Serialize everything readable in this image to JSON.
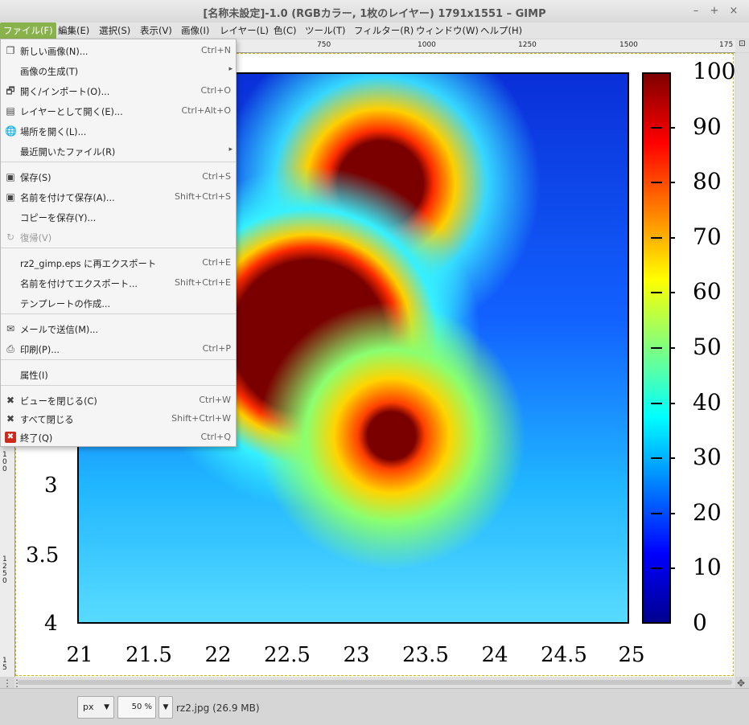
{
  "window": {
    "title": "[名称未設定]-1.0 (RGBカラー, 1枚のレイヤー) 1791x1551 – GIMP"
  },
  "menubar": [
    {
      "label": "ファイル(F)",
      "active": true
    },
    {
      "label": "編集(E)"
    },
    {
      "label": "選択(S)"
    },
    {
      "label": "表示(V)"
    },
    {
      "label": "画像(I)"
    },
    {
      "label": "レイヤー(L)"
    },
    {
      "label": "色(C)"
    },
    {
      "label": "ツール(T)"
    },
    {
      "label": "フィルター(R)"
    },
    {
      "label": "ウィンドウ(W)"
    },
    {
      "label": "ヘルプ(H)"
    }
  ],
  "file_menu": [
    {
      "label": "新しい画像(N)...",
      "shortcut": "Ctrl+N",
      "icon": "new-image-icon",
      "glyph": "❐"
    },
    {
      "label": "画像の生成(T)",
      "submenu": "▸"
    },
    {
      "label": "開く/インポート(O)...",
      "shortcut": "Ctrl+O",
      "icon": "open-icon",
      "glyph": "🗗"
    },
    {
      "label": "レイヤーとして開く(E)...",
      "shortcut": "Ctrl+Alt+O",
      "icon": "open-as-layer-icon",
      "glyph": "▤"
    },
    {
      "label": "場所を開く(L)...",
      "icon": "globe-icon",
      "glyph": "🌐"
    },
    {
      "label": "最近開いたファイル(R)",
      "submenu": "▸"
    },
    {
      "label": "保存(S)",
      "shortcut": "Ctrl+S",
      "icon": "save-icon",
      "glyph": "▣"
    },
    {
      "label": "名前を付けて保存(A)...",
      "shortcut": "Shift+Ctrl+S",
      "icon": "save-as-icon",
      "glyph": "▣"
    },
    {
      "label": "コピーを保存(Y)..."
    },
    {
      "label": "復帰(V)",
      "icon": "revert-icon",
      "glyph": "↻",
      "disabled": true
    },
    {
      "label": "rz2_gimp.eps に再エクスポート",
      "shortcut": "Ctrl+E"
    },
    {
      "label": "名前を付けてエクスポート...",
      "shortcut": "Shift+Ctrl+E"
    },
    {
      "label": "テンプレートの作成..."
    },
    {
      "label": "メールで送信(M)...",
      "icon": "mail-icon",
      "glyph": "✉"
    },
    {
      "label": "印刷(P)...",
      "shortcut": "Ctrl+P",
      "icon": "print-icon",
      "glyph": "⎙"
    },
    {
      "label": "属性(I)"
    },
    {
      "label": "ビューを閉じる(C)",
      "shortcut": "Ctrl+W",
      "icon": "close-view-icon",
      "glyph": "✖"
    },
    {
      "label": "すべて閉じる",
      "shortcut": "Shift+Ctrl+W",
      "icon": "close-all-icon",
      "glyph": "✖"
    },
    {
      "label": "終了(Q)",
      "shortcut": "Ctrl+Q",
      "icon": "quit-icon",
      "glyph": "✖"
    }
  ],
  "ruler": {
    "h_labels": [
      "750",
      "1000",
      "1250",
      "1500",
      "175"
    ],
    "v_labels": [
      "100",
      "1250",
      "15"
    ]
  },
  "plot": {
    "x_ticks": [
      "21",
      "21.5",
      "22",
      "22.5",
      "23",
      "23.5",
      "24",
      "24.5",
      "25"
    ],
    "y_ticks": [
      "3",
      "3.5",
      "4"
    ],
    "colorbar_ticks": [
      "100",
      "90",
      "80",
      "70",
      "60",
      "50",
      "40",
      "30",
      "20",
      "10",
      "0"
    ],
    "colorbar_colors": [
      "#7f0000",
      "#ff0000",
      "#ff8000",
      "#ffff00",
      "#80ff80",
      "#00ffff",
      "#0080ff",
      "#0000ff",
      "#00008f"
    ]
  },
  "statusbar": {
    "unit": "px",
    "zoom": "50 %",
    "file_info": "rz2.jpg (26.9 MB)"
  },
  "colors": {
    "menu_active": "#8ab24c",
    "quit_icon": "#cc2a1c"
  }
}
